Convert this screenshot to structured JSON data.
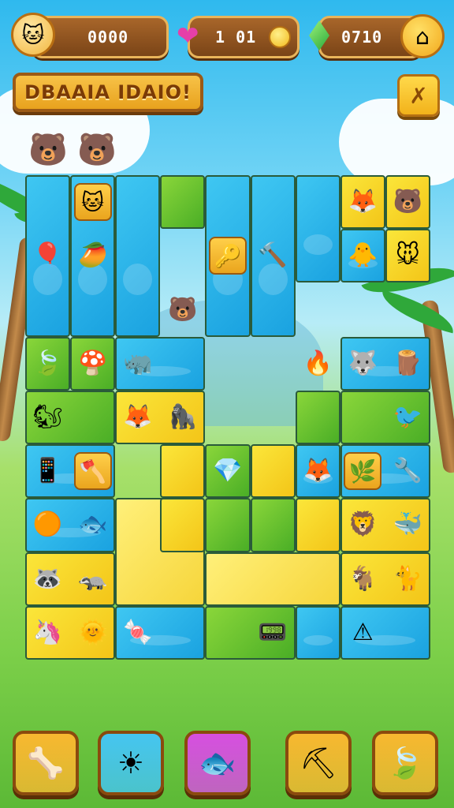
{
  "hud": {
    "score": {
      "value": "0000",
      "icon": "cat-face-icon"
    },
    "lives": {
      "value": "1 01",
      "icon": "heart-icon",
      "coin_icon": "coin-icon"
    },
    "gems": {
      "value": "0710",
      "icon": "green-gem-icon",
      "home_icon": "home-icon"
    }
  },
  "title": {
    "text": "DBAAIA IDAIO!"
  },
  "settings_button": {
    "icon": "tools-icon"
  },
  "board": {
    "tiles": [
      {
        "c": "blue",
        "r": 0,
        "col": 0,
        "w": 1,
        "h": 3
      },
      {
        "c": "blue",
        "r": 0,
        "col": 1,
        "w": 1,
        "h": 3
      },
      {
        "c": "blue",
        "r": 0,
        "col": 2,
        "w": 1,
        "h": 3
      },
      {
        "c": "green",
        "r": 0,
        "col": 3,
        "w": 1,
        "h": 1
      },
      {
        "c": "blue",
        "r": 0,
        "col": 4,
        "w": 1,
        "h": 3
      },
      {
        "c": "blue",
        "r": 0,
        "col": 5,
        "w": 1,
        "h": 3
      },
      {
        "c": "blue",
        "r": 0,
        "col": 6,
        "w": 1,
        "h": 2
      },
      {
        "c": "yellow",
        "r": 0,
        "col": 7,
        "w": 1,
        "h": 1
      },
      {
        "c": "blue",
        "r": 1,
        "col": 7,
        "w": 1,
        "h": 1
      },
      {
        "c": "yellow",
        "r": 1,
        "col": 8,
        "w": 1,
        "h": 1
      },
      {
        "c": "yellow",
        "r": 0,
        "col": 8,
        "w": 1,
        "h": 1
      },
      {
        "c": "green",
        "r": 3,
        "col": 0,
        "w": 1,
        "h": 1
      },
      {
        "c": "green",
        "r": 3,
        "col": 1,
        "w": 1,
        "h": 1
      },
      {
        "c": "blue",
        "r": 3,
        "col": 2,
        "w": 2,
        "h": 1
      },
      {
        "c": "blue",
        "r": 3,
        "col": 7,
        "w": 2,
        "h": 1
      },
      {
        "c": "green",
        "r": 4,
        "col": 0,
        "w": 2,
        "h": 1
      },
      {
        "c": "yellow",
        "r": 4,
        "col": 2,
        "w": 2,
        "h": 1
      },
      {
        "c": "green",
        "r": 4,
        "col": 6,
        "w": 1,
        "h": 1
      },
      {
        "c": "green",
        "r": 4,
        "col": 7,
        "w": 2,
        "h": 1
      },
      {
        "c": "blue",
        "r": 5,
        "col": 0,
        "w": 2,
        "h": 1
      },
      {
        "c": "yellow",
        "r": 5,
        "col": 3,
        "w": 1,
        "h": 1
      },
      {
        "c": "green",
        "r": 5,
        "col": 4,
        "w": 1,
        "h": 1
      },
      {
        "c": "yellow",
        "r": 5,
        "col": 5,
        "w": 1,
        "h": 1
      },
      {
        "c": "blue",
        "r": 5,
        "col": 6,
        "w": 1,
        "h": 1
      },
      {
        "c": "blue",
        "r": 5,
        "col": 7,
        "w": 2,
        "h": 1
      },
      {
        "c": "blue",
        "r": 6,
        "col": 0,
        "w": 2,
        "h": 1
      },
      {
        "c": "cream",
        "r": 6,
        "col": 2,
        "w": 2,
        "h": 2
      },
      {
        "c": "yellow",
        "r": 6,
        "col": 3,
        "w": 1,
        "h": 1
      },
      {
        "c": "green",
        "r": 6,
        "col": 4,
        "w": 1,
        "h": 1
      },
      {
        "c": "green",
        "r": 6,
        "col": 5,
        "w": 1,
        "h": 1
      },
      {
        "c": "yellow",
        "r": 6,
        "col": 6,
        "w": 1,
        "h": 1
      },
      {
        "c": "yellow",
        "r": 6,
        "col": 7,
        "w": 2,
        "h": 1
      },
      {
        "c": "cream",
        "r": 7,
        "col": 4,
        "w": 3,
        "h": 1
      },
      {
        "c": "yellow",
        "r": 7,
        "col": 0,
        "w": 2,
        "h": 1
      },
      {
        "c": "yellow",
        "r": 7,
        "col": 7,
        "w": 2,
        "h": 1
      },
      {
        "c": "yellow",
        "r": 8,
        "col": 0,
        "w": 2,
        "h": 1
      },
      {
        "c": "blue",
        "r": 8,
        "col": 2,
        "w": 2,
        "h": 1
      },
      {
        "c": "green",
        "r": 8,
        "col": 4,
        "w": 2,
        "h": 1
      },
      {
        "c": "blue",
        "r": 8,
        "col": 6,
        "w": 1,
        "h": 1
      },
      {
        "c": "blue",
        "r": 8,
        "col": 7,
        "w": 2,
        "h": 1
      }
    ],
    "pieces": [
      {
        "name": "cat-piece-pink",
        "glyph": "🐱",
        "r": 0,
        "col": 1,
        "slot": true
      },
      {
        "name": "green-block-piece",
        "glyph": "",
        "r": 0,
        "col": 3,
        "slot": false
      },
      {
        "name": "fox-piece",
        "glyph": "🦊",
        "r": 0,
        "col": 7,
        "slot": false
      },
      {
        "name": "bear-piece-orange",
        "glyph": "🐻",
        "r": 0,
        "col": 8,
        "slot": false
      },
      {
        "name": "balloon-piece",
        "glyph": "🎈",
        "r": 1,
        "col": 0,
        "slot": false
      },
      {
        "name": "mango-piece",
        "glyph": "🥭",
        "r": 1,
        "col": 1,
        "slot": false
      },
      {
        "name": "key-piece",
        "glyph": "🔑",
        "r": 1,
        "col": 4,
        "slot": true
      },
      {
        "name": "hammer-piece",
        "glyph": "🔨",
        "r": 1,
        "col": 5,
        "slot": false
      },
      {
        "name": "chick-piece",
        "glyph": "🐥",
        "r": 1,
        "col": 7,
        "slot": false
      },
      {
        "name": "mouse-piece",
        "glyph": "🐭",
        "r": 1,
        "col": 8,
        "slot": false
      },
      {
        "name": "bear-piece-black",
        "glyph": "🐻",
        "r": 2,
        "col": 3,
        "slot": false
      },
      {
        "name": "leaf-piece",
        "glyph": "🍃",
        "r": 3,
        "col": 0,
        "slot": false
      },
      {
        "name": "mushroom-piece",
        "glyph": "🍄",
        "r": 3,
        "col": 1,
        "slot": false
      },
      {
        "name": "rhino-piece",
        "glyph": "🦏",
        "r": 3,
        "col": 2,
        "slot": false
      },
      {
        "name": "flame-piece",
        "glyph": "🔥",
        "r": 3,
        "col": 6,
        "slot": false
      },
      {
        "name": "wolf-piece",
        "glyph": "🐺",
        "r": 3,
        "col": 7,
        "slot": false
      },
      {
        "name": "log-piece",
        "glyph": "🪵",
        "r": 3,
        "col": 8,
        "slot": false
      },
      {
        "name": "squirrel-piece",
        "glyph": "🐿",
        "r": 4,
        "col": 0,
        "slot": false
      },
      {
        "name": "fox-piece-2",
        "glyph": "🦊",
        "r": 4,
        "col": 2,
        "slot": false
      },
      {
        "name": "gorilla-piece",
        "glyph": "🦍",
        "r": 4,
        "col": 3,
        "slot": false
      },
      {
        "name": "bird-piece",
        "glyph": "🐦",
        "r": 4,
        "col": 8,
        "slot": false
      },
      {
        "name": "phone-piece",
        "glyph": "📱",
        "r": 5,
        "col": 0,
        "slot": false
      },
      {
        "name": "axe-piece",
        "glyph": "🪓",
        "r": 5,
        "col": 1,
        "slot": true
      },
      {
        "name": "crystal-piece",
        "glyph": "💎",
        "r": 5,
        "col": 4,
        "slot": false
      },
      {
        "name": "fox-piece-3",
        "glyph": "🦊",
        "r": 5,
        "col": 6,
        "slot": false
      },
      {
        "name": "sprout-piece",
        "glyph": "🌿",
        "r": 5,
        "col": 7,
        "slot": true
      },
      {
        "name": "tool-piece",
        "glyph": "🔧",
        "r": 5,
        "col": 8,
        "slot": false
      },
      {
        "name": "orange-piece",
        "glyph": "🟠",
        "r": 6,
        "col": 0,
        "slot": false
      },
      {
        "name": "fish-piece",
        "glyph": "🐟",
        "r": 6,
        "col": 1,
        "slot": false
      },
      {
        "name": "lion-piece",
        "glyph": "🦁",
        "r": 6,
        "col": 7,
        "slot": false
      },
      {
        "name": "whale-piece",
        "glyph": "🐳",
        "r": 6,
        "col": 8,
        "slot": false
      },
      {
        "name": "raccoon-piece",
        "glyph": "🦝",
        "r": 7,
        "col": 0,
        "slot": false
      },
      {
        "name": "badger-piece",
        "glyph": "🦡",
        "r": 7,
        "col": 1,
        "slot": false
      },
      {
        "name": "goat-piece",
        "glyph": "🐐",
        "r": 7,
        "col": 7,
        "slot": false
      },
      {
        "name": "cat-piece-blue",
        "glyph": "🐈",
        "r": 7,
        "col": 8,
        "slot": false
      },
      {
        "name": "unicorn-piece",
        "glyph": "🦄",
        "r": 8,
        "col": 0,
        "slot": false
      },
      {
        "name": "sun-monster-piece",
        "glyph": "🌞",
        "r": 8,
        "col": 1,
        "slot": false
      },
      {
        "name": "candy-piece",
        "glyph": "🍬",
        "r": 8,
        "col": 2,
        "slot": false
      },
      {
        "name": "remote-piece",
        "glyph": "📟",
        "r": 8,
        "col": 5,
        "slot": false
      },
      {
        "name": "warning-piece",
        "glyph": "⚠",
        "r": 8,
        "col": 7,
        "slot": false
      }
    ]
  },
  "decor": {
    "top_animals": [
      {
        "glyph": "🐻",
        "name": "bear-decor-1"
      },
      {
        "glyph": "🐻",
        "name": "bear-decor-2"
      }
    ]
  },
  "powerups": [
    {
      "name": "powerup-bone",
      "icon": "🦴",
      "bg": "#f7b830"
    },
    {
      "name": "powerup-sun",
      "icon": "☀",
      "bg": "#45c5f0"
    },
    {
      "name": "powerup-fish",
      "icon": "🐟",
      "bg": "#d64fe0"
    },
    {
      "name": "powerup-shovel",
      "icon": "⛏",
      "bg": "#f7b830"
    },
    {
      "name": "powerup-leaf",
      "icon": "🍃",
      "bg": "#f7b830"
    }
  ]
}
